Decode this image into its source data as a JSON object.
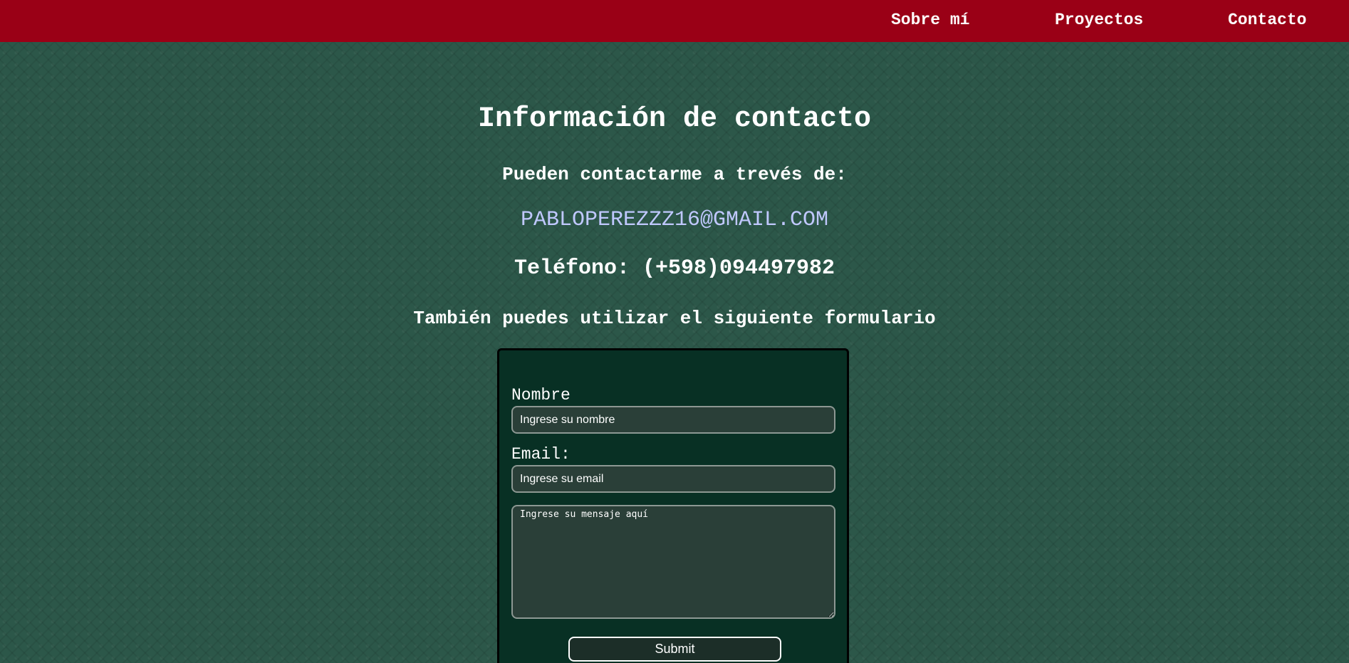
{
  "nav": {
    "items": [
      {
        "label": "Sobre mí"
      },
      {
        "label": "Proyectos"
      },
      {
        "label": "Contacto"
      }
    ]
  },
  "contact": {
    "title": "Información de contacto",
    "subtitle": "Pueden contactarme a trevés de:",
    "email": "PABLOPEREZZZ16@GMAIL.COM",
    "phone": "Teléfono: (+598)094497982",
    "form_hint": "También puedes utilizar el siguiente formulario"
  },
  "form": {
    "name_label": "Nombre",
    "name_placeholder": "Ingrese su nombre",
    "email_label": "Email:",
    "email_placeholder": "Ingrese su email",
    "message_placeholder": "Ingrese su mensaje aquí",
    "submit_label": "Submit"
  },
  "colors": {
    "navbar": "#9a0016",
    "background": "#2c5749",
    "form_background": "#083024",
    "email_link": "#c0c8ff"
  }
}
